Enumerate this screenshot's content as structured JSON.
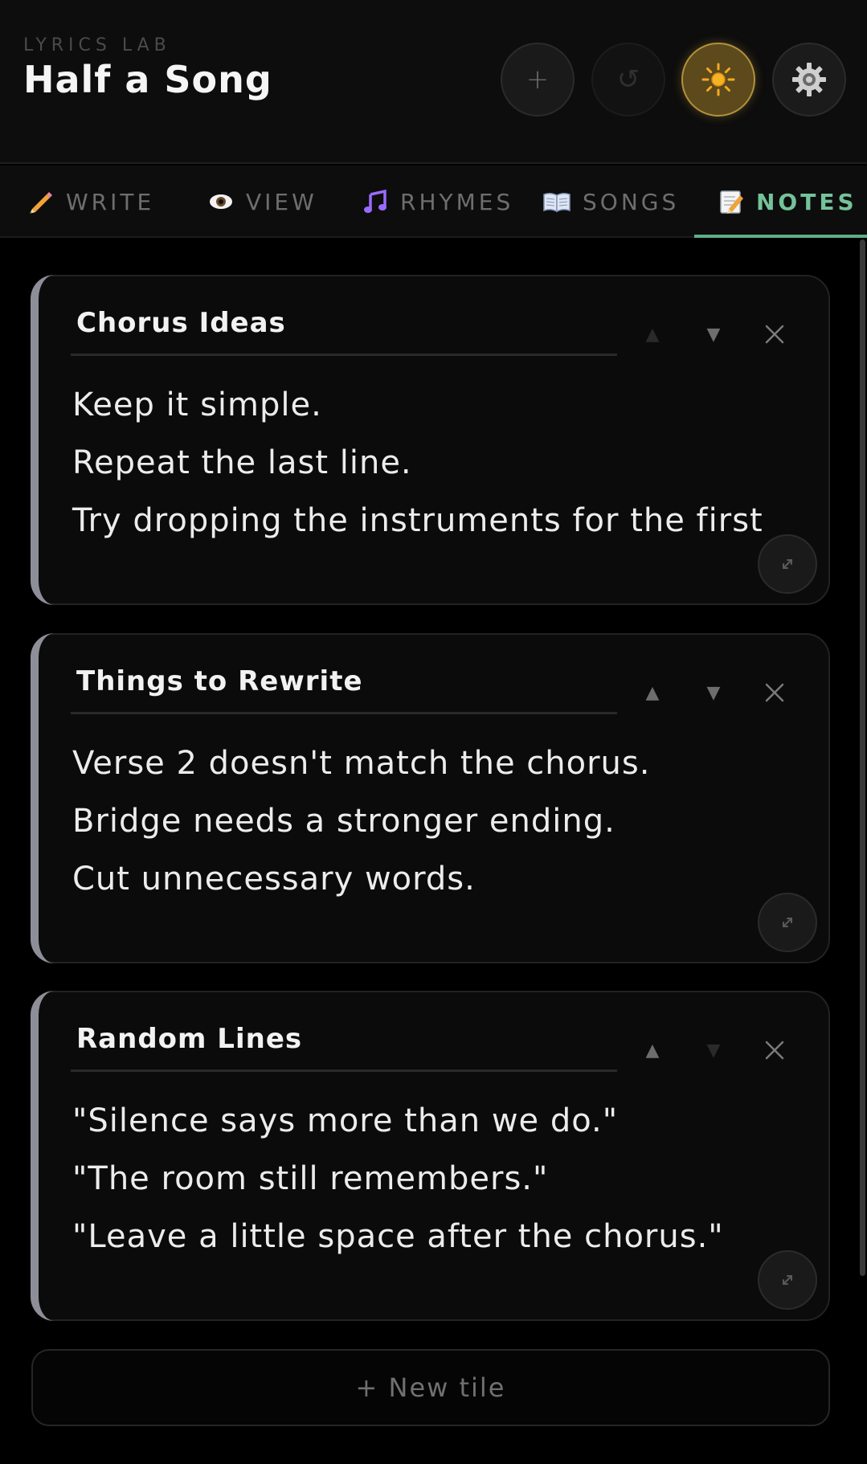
{
  "header": {
    "kicker": "LYRICS LAB",
    "title": "Half a Song",
    "buttons": {
      "add_symbol": "+",
      "undo_symbol": "↺"
    }
  },
  "tabs": [
    {
      "icon": "pencil-icon",
      "label": "WRITE"
    },
    {
      "icon": "eye-icon",
      "label": "VIEW"
    },
    {
      "icon": "music-note-icon",
      "label": "RHYMES"
    },
    {
      "icon": "book-icon",
      "label": "SONGS"
    },
    {
      "icon": "notepad-icon",
      "label": "NOTES",
      "active": true
    }
  ],
  "cards": [
    {
      "title": "Chorus Ideas",
      "lines": [
        "Keep it simple.",
        "Repeat the last line.",
        "Try dropping the instruments for the first"
      ],
      "can_move_up": false,
      "can_move_down": true
    },
    {
      "title": "Things to Rewrite",
      "lines": [
        "Verse 2 doesn't match the chorus.",
        "Bridge needs a stronger ending.",
        "Cut unnecessary words."
      ],
      "can_move_up": true,
      "can_move_down": true
    },
    {
      "title": "Random Lines",
      "lines": [
        "\"Silence says more than we do.\"",
        "\"The room still remembers.\"",
        "\"Leave a little space after the chorus.\""
      ],
      "can_move_up": true,
      "can_move_down": false
    }
  ],
  "card_controls": {
    "up_symbol": "▲",
    "down_symbol": "▼"
  },
  "new_tile_label": "+ New tile",
  "colors": {
    "background": "#000000",
    "accent_green": "#74c29a",
    "theme_button": "#5c4a1d",
    "card_accent": "#8e8e98"
  }
}
